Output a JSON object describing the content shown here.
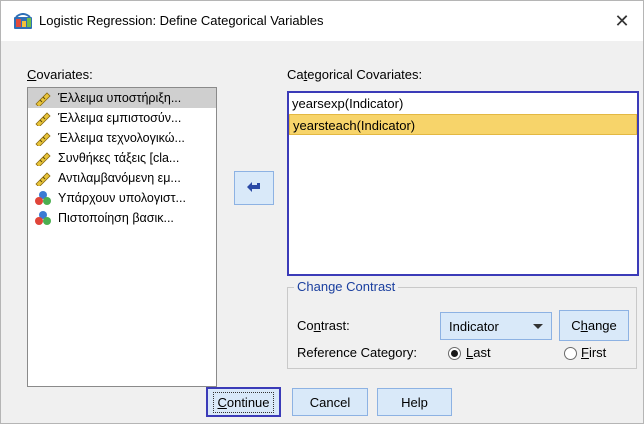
{
  "window": {
    "title": "Logistic Regression: Define Categorical Variables",
    "close_glyph": "✕"
  },
  "covariates": {
    "label_accel": "C",
    "label_rest": "ovariates:",
    "items": [
      {
        "label": "Έλλειμα υποστήριξη...",
        "icon": "scale-ruler-icon",
        "selected": true
      },
      {
        "label": "Έλλειμα εμπιστοσύν...",
        "icon": "scale-ruler-icon",
        "selected": false
      },
      {
        "label": "Έλλειμα τεχνολογικώ...",
        "icon": "scale-ruler-icon",
        "selected": false
      },
      {
        "label": "Συνθήκες τάξεις [cla...",
        "icon": "scale-ruler-icon",
        "selected": false
      },
      {
        "label": "Αντιλαμβανόμενη εμ...",
        "icon": "scale-ruler-icon",
        "selected": false
      },
      {
        "label": "Υπάρχουν υπολογιστ...",
        "icon": "nominal-circles-icon",
        "selected": false
      },
      {
        "label": "Πιστοποίηση βασικ...",
        "icon": "nominal-circles-icon",
        "selected": false
      }
    ]
  },
  "categorical": {
    "label_pre": "Ca",
    "label_accel": "t",
    "label_post": "egorical Covariates:",
    "items": [
      {
        "label": "yearsexp(Indicator)",
        "selected": false
      },
      {
        "label": "yearsteach(Indicator)",
        "selected": true
      }
    ]
  },
  "move_button": {
    "icon": "arrow-left-icon"
  },
  "change_contrast": {
    "title": "Change Contrast",
    "contrast_label_pre": "Co",
    "contrast_label_accel": "n",
    "contrast_label_post": "trast:",
    "contrast_value": "Indicator",
    "change_accel": "h",
    "change_pre": "C",
    "change_post": "ange",
    "reference_label": "Reference Category:",
    "last_accel": "L",
    "last_rest": "ast",
    "first_accel": "F",
    "first_rest": "irst",
    "selected_reference": "Last"
  },
  "buttons": {
    "continue_accel": "C",
    "continue_rest": "ontinue",
    "cancel": "Cancel",
    "help": "Help"
  },
  "colors": {
    "button_face": "#d9e9f9",
    "focus_border": "#3b3bb8",
    "selection_highlight": "#f7d46a",
    "group_title": "#1a3f9f"
  }
}
